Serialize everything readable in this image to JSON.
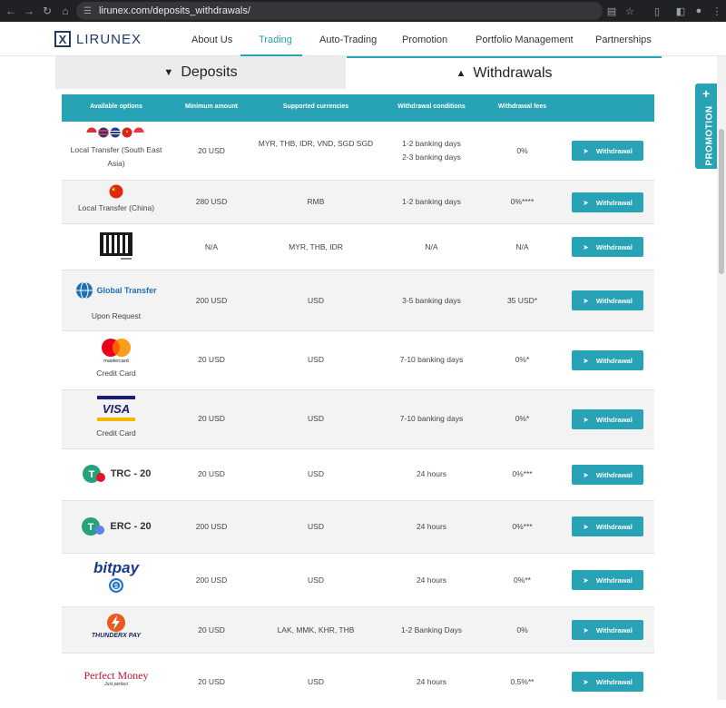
{
  "browser": {
    "url": "lirunex.com/deposits_withdrawals/"
  },
  "site": {
    "logo_text": "LIRUNEX",
    "menu": [
      "About Us",
      "Trading",
      "Auto-Trading",
      "Promotion",
      "Portfolio Management",
      "Partnerships"
    ],
    "active_menu": "Trading"
  },
  "tabs": {
    "deposits": "Deposits",
    "withdrawals": "Withdrawals"
  },
  "promotion_label": "PROMOTION",
  "table": {
    "headers": [
      "Available options",
      "Minimum amount",
      "Supported currencies",
      "Withdrawal conditions",
      "Withdrawal fees"
    ],
    "button_label": "Withdrawal",
    "rows": [
      {
        "option": "Local Transfer (South East Asia)",
        "logo": "sea-flags-icon",
        "min": "20 USD",
        "currencies": "MYR, THB, IDR, VND, SGD SGD",
        "conditions": "1-2 banking days 2-3 banking days",
        "fees": "0%"
      },
      {
        "option": "Local Transfer (China)",
        "logo": "china-flag-icon",
        "min": "280 USD",
        "currencies": "RMB",
        "conditions": "1-2 banking days",
        "fees": "0%****"
      },
      {
        "option": "",
        "logo": "help2pay-icon",
        "min": "N/A",
        "currencies": "MYR, THB, IDR",
        "conditions": "N/A",
        "fees": "N/A"
      },
      {
        "option": "Upon Request",
        "logo": "swift-global-transfer-icon",
        "logo_text": "Global Transfer",
        "min": "200 USD",
        "currencies": "USD",
        "conditions": "3-5 banking days",
        "fees": "35 USD*"
      },
      {
        "option": "Credit Card",
        "logo": "mastercard-icon",
        "logo_text": "mastercard",
        "min": "20 USD",
        "currencies": "USD",
        "conditions": "7-10 banking days",
        "fees": "0%*"
      },
      {
        "option": "Credit Card",
        "logo": "visa-icon",
        "logo_text": "VISA",
        "min": "20 USD",
        "currencies": "USD",
        "conditions": "7-10 banking days",
        "fees": "0%*"
      },
      {
        "option": "",
        "logo": "tether-trc20-icon",
        "logo_text": "TRC - 20",
        "min": "20 USD",
        "currencies": "USD",
        "conditions": "24 hours",
        "fees": "0%***"
      },
      {
        "option": "",
        "logo": "tether-erc20-icon",
        "logo_text": "ERC - 20",
        "min": "200 USD",
        "currencies": "USD",
        "conditions": "24 hours",
        "fees": "0%***"
      },
      {
        "option": "",
        "logo": "bitpay-icon",
        "logo_text": "bitpay",
        "min": "200 USD",
        "currencies": "USD",
        "conditions": "24 hours",
        "fees": "0%**"
      },
      {
        "option": "",
        "logo": "thunderx-pay-icon",
        "logo_text": "THUNDERX PAY",
        "min": "20 USD",
        "currencies": "LAK, MMK, KHR, THB",
        "conditions": "1-2 Banking Days",
        "fees": "0%"
      },
      {
        "option": "",
        "logo": "perfect-money-icon",
        "logo_text": "Perfect Money",
        "logo_subtext": "Just perfect",
        "min": "20 USD",
        "currencies": "USD",
        "conditions": "24 hours",
        "fees": "0.5%**"
      }
    ]
  },
  "colors": {
    "accent": "#27a3b5",
    "brand_navy": "#1f3b63"
  }
}
